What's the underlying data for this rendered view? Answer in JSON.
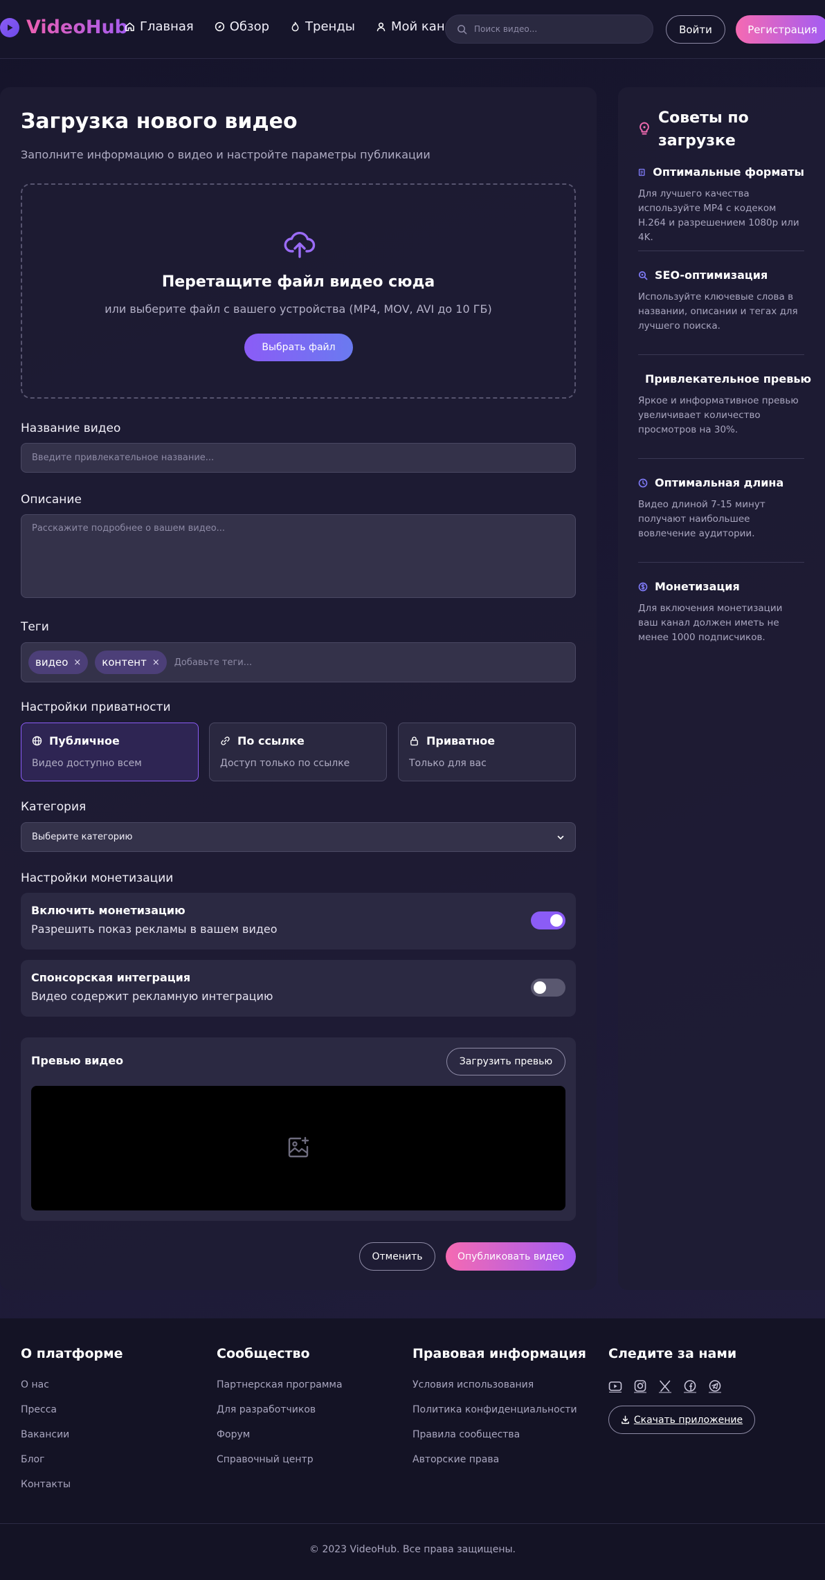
{
  "header": {
    "logo": "VideoHub",
    "nav": [
      {
        "label": "Главная",
        "icon": "home-icon"
      },
      {
        "label": "Обзор",
        "icon": "compass-icon"
      },
      {
        "label": "Тренды",
        "icon": "flame-icon"
      },
      {
        "label": "Мой канал",
        "icon": "user-icon"
      }
    ],
    "search_placeholder": "Поиск видео...",
    "login_label": "Войти",
    "register_label": "Регистрация"
  },
  "upload": {
    "title": "Загрузка нового видео",
    "subtitle": "Заполните информацию о видео и настройте параметры публикации",
    "drop_title": "Перетащите файл видео сюда",
    "drop_sub": "или выберите файл с вашего устройства (MP4, MOV, AVI до 10 ГБ)",
    "choose_label": "Выбрать файл"
  },
  "form": {
    "title_label": "Название видео",
    "title_placeholder": "Введите привлекательное название...",
    "desc_label": "Описание",
    "desc_placeholder": "Расскажите подробнее о вашем видео...",
    "tags_label": "Теги",
    "tags": [
      "видео",
      "контент"
    ],
    "tags_remove": "×",
    "tags_placeholder": "Добавьте теги...",
    "privacy_label": "Настройки приватности",
    "privacy": [
      {
        "title": "Публичное",
        "desc": "Видео доступно всем",
        "icon": "globe-icon",
        "active": true
      },
      {
        "title": "По ссылке",
        "desc": "Доступ только по ссылке",
        "icon": "link-icon",
        "active": false
      },
      {
        "title": "Приватное",
        "desc": "Только для вас",
        "icon": "lock-icon",
        "active": false
      }
    ],
    "category_label": "Категория",
    "category_value": "Выберите категорию",
    "monetization_label": "Настройки монетизации",
    "toggles": [
      {
        "title": "Включить монетизацию",
        "desc": "Разрешить показ рекламы в вашем видео",
        "on": true
      },
      {
        "title": "Спонсорская интеграция",
        "desc": "Видео содержит рекламную интеграцию",
        "on": false
      }
    ],
    "preview_title": "Превью видео",
    "preview_button": "Загрузить превью",
    "cancel_label": "Отменить",
    "publish_label": "Опубликовать видео"
  },
  "tips": {
    "title": "Советы по загрузке",
    "items": [
      {
        "title": "Оптимальные форматы",
        "text": "Для лучшего качества используйте MP4 с кодеком H.264 и разрешением 1080p или 4K.",
        "icon": "file-icon"
      },
      {
        "title": "SEO-оптимизация",
        "text": "Используйте ключевые слова в названии, описании и тегах для лучшего поиска.",
        "icon": "search-icon"
      },
      {
        "title": "Привлекательное превью",
        "text": "Яркое и информативное превью увеличивает количество просмотров на 30%.",
        "icon": "image-icon"
      },
      {
        "title": "Оптимальная длина",
        "text": "Видео длиной 7-15 минут получают наибольшее вовлечение аудитории.",
        "icon": "clock-icon"
      },
      {
        "title": "Монетизация",
        "text": "Для включения монетизации ваш канал должен иметь не менее 1000 подписчиков.",
        "icon": "dollar-icon"
      }
    ]
  },
  "footer": {
    "columns": [
      {
        "title": "О платформе",
        "links": [
          "О нас",
          "Пресса",
          "Вакансии",
          "Блог",
          "Контакты"
        ]
      },
      {
        "title": "Сообщество",
        "links": [
          "Партнерская программа",
          "Для разработчиков",
          "Форум",
          "Справочный центр"
        ]
      },
      {
        "title": "Правовая информация",
        "links": [
          "Условия использования",
          "Политика конфиденциальности",
          "Правила сообщества",
          "Авторские права"
        ]
      }
    ],
    "social_title": "Следите за нами",
    "socials": [
      "youtube-icon",
      "instagram-icon",
      "x-icon",
      "facebook-icon",
      "telegram-icon"
    ],
    "app_button": "Скачать приложение",
    "copyright": "© 2023 VideoHub. Все права защищены."
  },
  "colors": {
    "accent": "#8b5cf6",
    "pink": "#f56ab2",
    "background": "#1b1833"
  }
}
